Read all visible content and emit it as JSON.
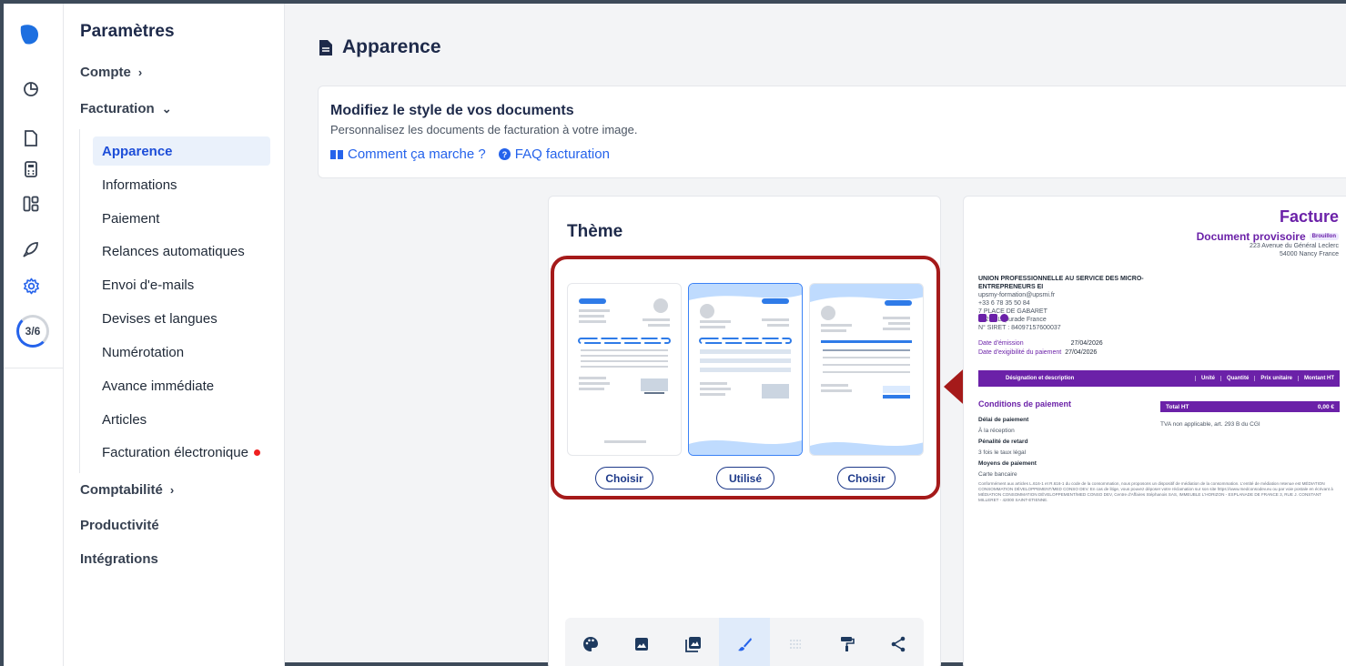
{
  "rail": {
    "icons": [
      "logo-icon",
      "clock-icon",
      "document-icon",
      "calculator-icon",
      "dashboard-icon",
      "rocket-icon",
      "gear-icon"
    ],
    "progress": "3/6"
  },
  "sidebar": {
    "title": "Paramètres",
    "compte": "Compte",
    "facturation": "Facturation",
    "items": [
      {
        "label": "Apparence"
      },
      {
        "label": "Informations"
      },
      {
        "label": "Paiement"
      },
      {
        "label": "Relances automatiques"
      },
      {
        "label": "Envoi d'e-mails"
      },
      {
        "label": "Devises et langues"
      },
      {
        "label": "Numérotation"
      },
      {
        "label": "Avance immédiate"
      },
      {
        "label": "Articles"
      },
      {
        "label": "Facturation électronique"
      }
    ],
    "comptabilite": "Comptabilité",
    "productivite": "Productivité",
    "integrations": "Intégrations"
  },
  "page": {
    "title": "Apparence"
  },
  "intro": {
    "heading": "Modifiez le style de vos documents",
    "subtitle": "Personnalisez les documents de facturation à votre image.",
    "link_how": "Comment ça marche ?",
    "link_faq": "FAQ facturation"
  },
  "theme": {
    "title": "Thème",
    "buttons": [
      "Choisir",
      "Utilisé",
      "Choisir"
    ]
  },
  "toolbar": {
    "icons": [
      "palette-icon",
      "image-icon",
      "images-icon",
      "brush-icon",
      "grid-icon",
      "paint-roller-icon",
      "share-icon"
    ],
    "active_index": 3
  },
  "preview": {
    "title": "Facture",
    "subtitle": "Document provisoire",
    "badge": "Brouillon",
    "addr1": "223 Avenue du Général Leclerc",
    "addr2": "54000 Nancy France",
    "company1": "UNION PROFESSIONNELLE AU SERVICE DES MICRO-",
    "company2": "ENTREPRENEURS EI",
    "email": "upsmy-formation@upsmi.fr",
    "phone": "+33 6 78 35 50 84",
    "street": "7 PLACE DE GABARET",
    "city": "47260 Lapurade France",
    "siret": "N° SIRET : 84097157600037",
    "date_emission_label": "Date d'émission",
    "date_emission": "27/04/2026",
    "date_exig_label": "Date d'exigibilité du paiement",
    "date_exig": "27/04/2026",
    "table_headers": [
      "Désignation et description",
      "Unité",
      "Quantité",
      "Prix unitaire",
      "Montant HT"
    ],
    "conditions": "Conditions de paiement",
    "delai_label": "Délai de paiement",
    "delai": "À la réception",
    "penalite_label": "Pénalité de retard",
    "penalite": "3 fois le taux légal",
    "moyens_label": "Moyens de paiement",
    "moyens": "Carte bancaire",
    "total_label": "Total HT",
    "total_value": "0,00 €",
    "tva": "TVA non applicable, art. 293 B du CGI",
    "legal": "Conformément aux articles L.616-1 et R.616-1 du code de la consommation, nous proposons un dispositif de médiation de la consommation. L'entité de médiation retenue est MÉDIATION CONSOMMATION DÉVELOPPEMENT/MED CONSO DEV. En cas de litige, vous pouvez déposer votre réclamation sur son site https://www.medconsodev.eu ou par voie postale en écrivant à MÉDIATION CONSOMMATION DÉVELOPPEMENT/MED CONSO DEV, Centre d'Affaires Stéphanois SAS, IMMEUBLE L'HORIZON - ESPLANADE DE FRANCE 3, RUE J. CONSTANT MILLERET - 42000 SAINT-ETIENNE."
  },
  "colors": {
    "accent": "#2563eb",
    "brand_purple": "#6b21a8",
    "highlight": "#a51a1a"
  }
}
